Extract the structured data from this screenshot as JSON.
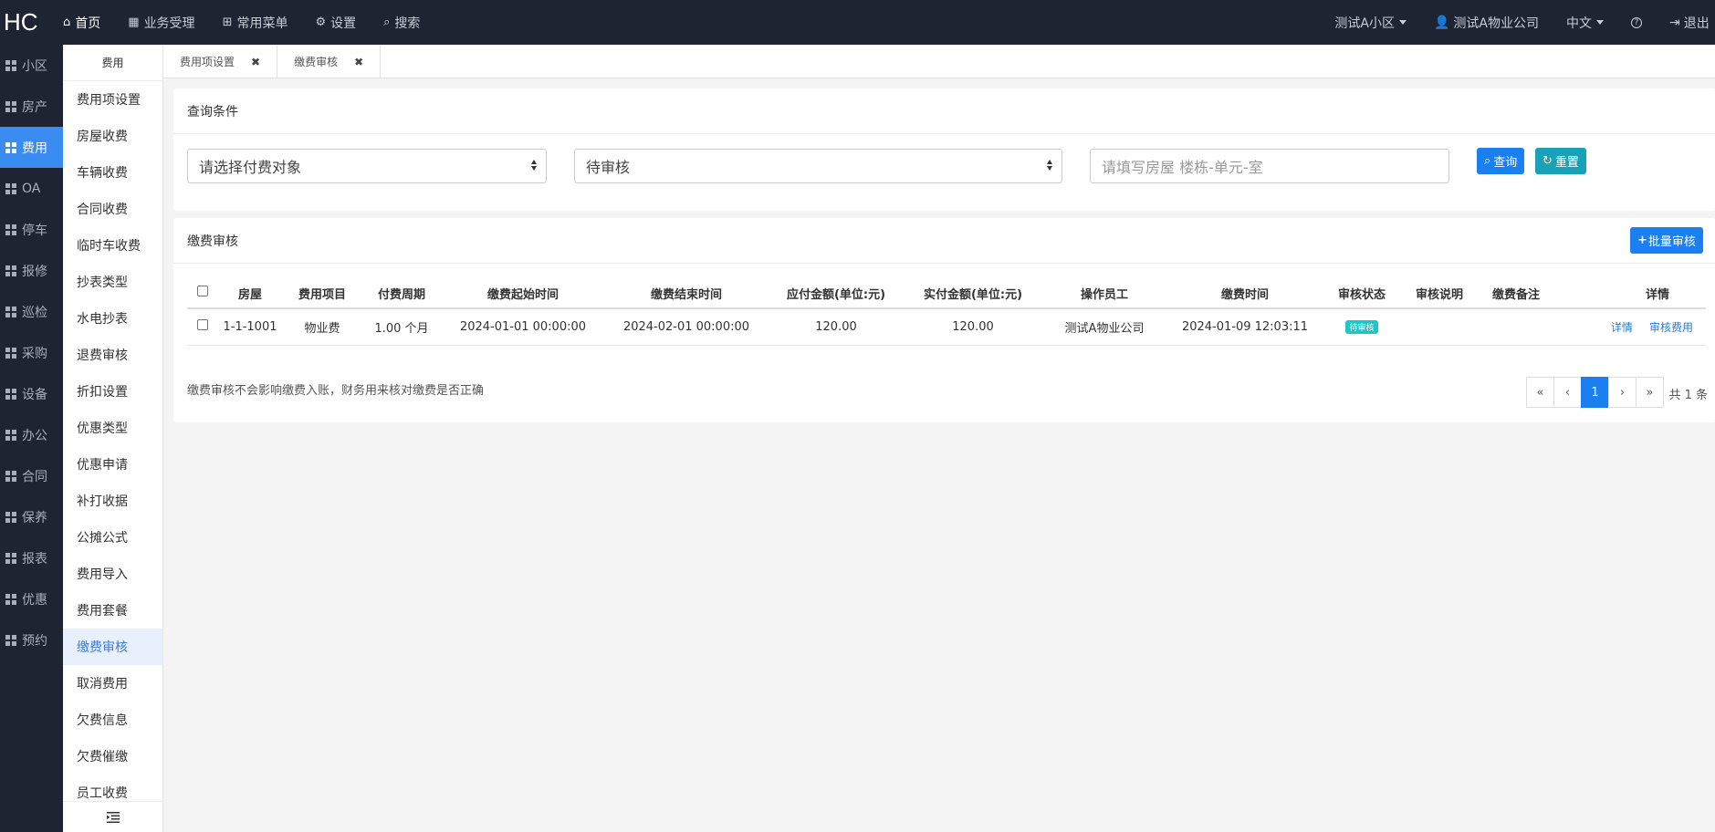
{
  "app": {
    "logo": "HC"
  },
  "topnav": [
    {
      "icon": "home-icon",
      "glyph": "⌂",
      "label": "首页",
      "active": true
    },
    {
      "icon": "grid-icon",
      "glyph": "▦",
      "label": "业务受理"
    },
    {
      "icon": "sitemap-icon",
      "glyph": "⊞",
      "label": "常用菜单"
    },
    {
      "icon": "gear-icon",
      "glyph": "⚙",
      "label": "设置"
    },
    {
      "icon": "search-icon",
      "glyph": "⌕",
      "label": "搜索"
    }
  ],
  "topright": {
    "community": "测试A小区",
    "company": "测试A物业公司",
    "language": "中文",
    "help": "?",
    "logout": "退出"
  },
  "leftbar": [
    "小区",
    "房产",
    "费用",
    "OA",
    "停车",
    "报修",
    "巡检",
    "采购",
    "设备",
    "办公",
    "合同",
    "保养",
    "报表",
    "优惠",
    "预约"
  ],
  "leftbar_active": "费用",
  "submenu": {
    "title": "费用",
    "items": [
      "费用项设置",
      "房屋收费",
      "车辆收费",
      "合同收费",
      "临时车收费",
      "抄表类型",
      "水电抄表",
      "退费审核",
      "折扣设置",
      "优惠类型",
      "优惠申请",
      "补打收据",
      "公摊公式",
      "费用导入",
      "费用套餐",
      "缴费审核",
      "取消费用",
      "欠费信息",
      "欠费催缴",
      "员工收费"
    ],
    "active": "缴费审核"
  },
  "tabs": [
    {
      "label": "费用项设置",
      "close": "✖"
    },
    {
      "label": "缴费审核",
      "close": "✖"
    }
  ],
  "query": {
    "title": "查询条件",
    "payer_select": "请选择付费对象",
    "status_select": "待审核",
    "room_placeholder": "请填写房屋 楼栋-单元-室",
    "search_btn": "查询",
    "reset_btn": "重置"
  },
  "audit": {
    "title": "缴费审核",
    "batch_btn": "批量审核",
    "columns": [
      "房屋",
      "费用项目",
      "付费周期",
      "缴费起始时间",
      "缴费结束时间",
      "应付金额(单位:元)",
      "实付金额(单位:元)",
      "操作员工",
      "缴费时间",
      "审核状态",
      "审核说明",
      "缴费备注",
      "详情"
    ],
    "rows": [
      {
        "room": "1-1-1001",
        "item": "物业费",
        "cycle": "1.00 个月",
        "start": "2024-01-01 00:00:00",
        "end": "2024-02-01 00:00:00",
        "due": "120.00",
        "paid": "120.00",
        "operator": "测试A物业公司",
        "paytime": "2024-01-09 12:03:11",
        "status": "待审核",
        "remark": "",
        "note": "",
        "detail_link": "详情",
        "audit_link": "审核费用"
      }
    ],
    "footnote": "缴费审核不会影响缴费入账，财务用来核对缴费是否正确",
    "pager": {
      "first": "«",
      "prev": "‹",
      "current": "1",
      "next": "›",
      "last": "»"
    },
    "total": "共 1 条"
  }
}
